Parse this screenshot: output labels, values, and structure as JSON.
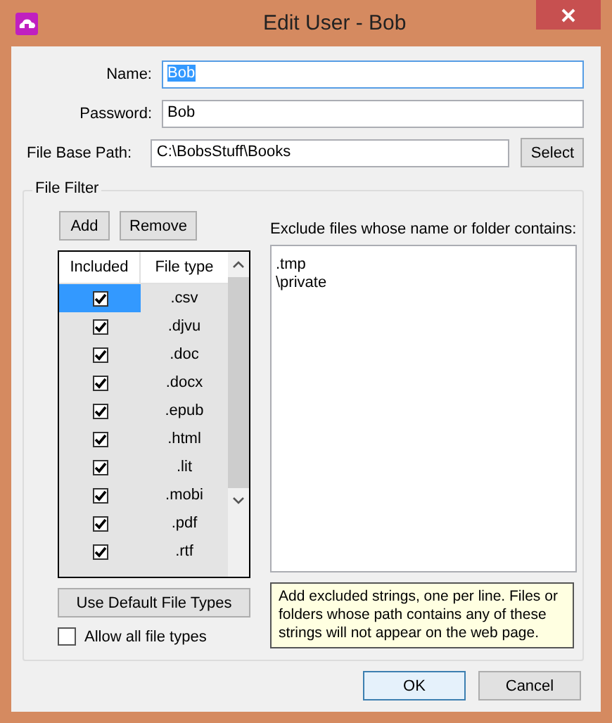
{
  "window": {
    "title": "Edit User - Bob"
  },
  "fields": [
    {
      "label": "Name:",
      "value": "Bob",
      "selected": true
    },
    {
      "label": "Password:",
      "value": "Bob",
      "selected": false
    }
  ],
  "base_path": {
    "label": "File Base Path:",
    "value": "C:\\BobsStuff\\Books",
    "button": "Select"
  },
  "file_filter": {
    "title": "File Filter",
    "add_button": "Add",
    "remove_button": "Remove",
    "columns": [
      "Included",
      "File type"
    ],
    "rows": [
      {
        "included": true,
        "type": ".csv",
        "selected": true
      },
      {
        "included": true,
        "type": ".djvu",
        "selected": false
      },
      {
        "included": true,
        "type": ".doc",
        "selected": false
      },
      {
        "included": true,
        "type": ".docx",
        "selected": false
      },
      {
        "included": true,
        "type": ".epub",
        "selected": false
      },
      {
        "included": true,
        "type": ".html",
        "selected": false
      },
      {
        "included": true,
        "type": ".lit",
        "selected": false
      },
      {
        "included": true,
        "type": ".mobi",
        "selected": false
      },
      {
        "included": true,
        "type": ".pdf",
        "selected": false
      },
      {
        "included": true,
        "type": ".rtf",
        "selected": false
      }
    ],
    "default_button": "Use Default File Types",
    "allow_all": {
      "label": "Allow all file types",
      "checked": false
    },
    "exclude_label": "Exclude files whose name or folder contains:",
    "exclude_lines": [
      ".tmp",
      "\\private"
    ],
    "hint": "Add excluded strings, one per line.  Files or folders whose path contains any of these strings will not appear on the web page."
  },
  "buttons": [
    "OK",
    "Cancel"
  ]
}
